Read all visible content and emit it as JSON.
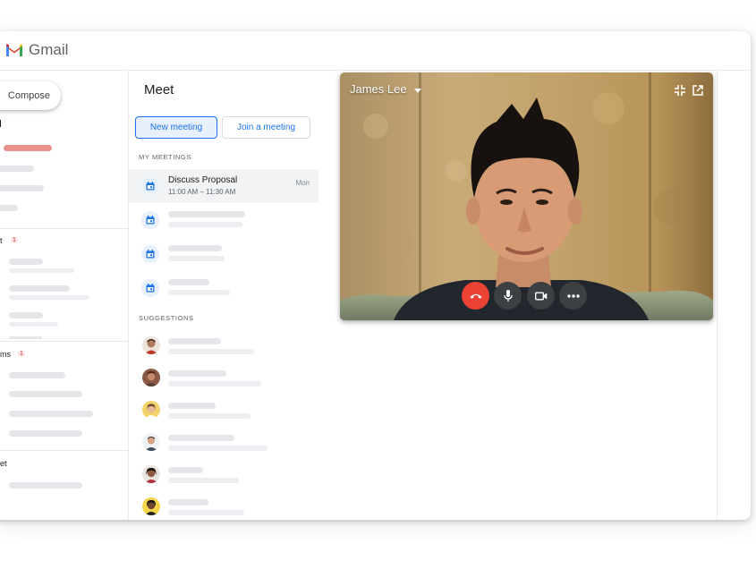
{
  "app": {
    "name": "Gmail"
  },
  "nav": {
    "compose_label": "Compose",
    "sections": [
      {
        "label_fragment": "t",
        "badge": "1"
      },
      {
        "label_fragment": "ms",
        "badge": "1"
      },
      {
        "label_fragment": "et"
      }
    ]
  },
  "meet": {
    "title": "Meet",
    "new_meeting_label": "New meeting",
    "join_label": "Join a meeting",
    "my_meetings_label": "MY MEETINGS",
    "meetings": [
      {
        "title": "Discuss Proposal",
        "time": "11:00 AM – 11:30 AM",
        "day": "Mon"
      }
    ],
    "suggestions_label": "SUGGESTIONS"
  },
  "video": {
    "participant_name": "James Lee",
    "icons": [
      "exit-fullscreen-icon",
      "open-in-new-icon"
    ],
    "controls": [
      "end-call-icon",
      "microphone-icon",
      "camera-icon",
      "more-options-icon"
    ]
  },
  "colors": {
    "accent": "#1a73e8",
    "end_call": "#ea4335",
    "badge": "#d93025",
    "control_dark": "#3c4043"
  }
}
